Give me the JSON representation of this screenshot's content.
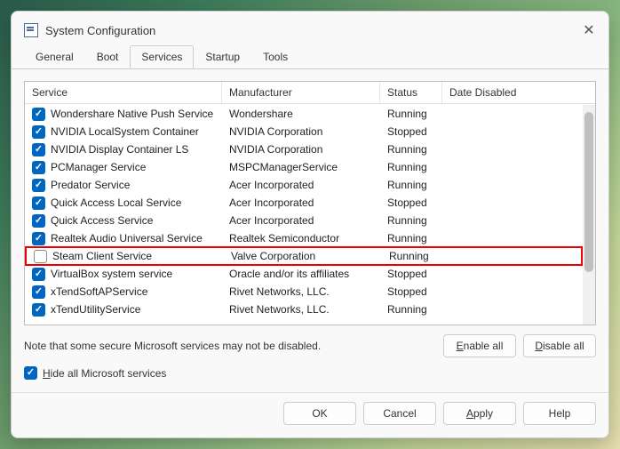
{
  "window": {
    "title": "System Configuration"
  },
  "tabs": [
    {
      "label": "General"
    },
    {
      "label": "Boot"
    },
    {
      "label": "Services",
      "active": true
    },
    {
      "label": "Startup"
    },
    {
      "label": "Tools"
    }
  ],
  "columns": {
    "service": "Service",
    "manufacturer": "Manufacturer",
    "status": "Status",
    "date": "Date Disabled"
  },
  "services": [
    {
      "checked": true,
      "name": "Wondershare Native Push Service",
      "manufacturer": "Wondershare",
      "status": "Running",
      "highlight": false
    },
    {
      "checked": true,
      "name": "NVIDIA LocalSystem Container",
      "manufacturer": "NVIDIA Corporation",
      "status": "Stopped",
      "highlight": false
    },
    {
      "checked": true,
      "name": "NVIDIA Display Container LS",
      "manufacturer": "NVIDIA Corporation",
      "status": "Running",
      "highlight": false
    },
    {
      "checked": true,
      "name": "PCManager Service",
      "manufacturer": "MSPCManagerService",
      "status": "Running",
      "highlight": false
    },
    {
      "checked": true,
      "name": "Predator Service",
      "manufacturer": "Acer Incorporated",
      "status": "Running",
      "highlight": false
    },
    {
      "checked": true,
      "name": "Quick Access Local Service",
      "manufacturer": "Acer Incorporated",
      "status": "Stopped",
      "highlight": false
    },
    {
      "checked": true,
      "name": "Quick Access Service",
      "manufacturer": "Acer Incorporated",
      "status": "Running",
      "highlight": false
    },
    {
      "checked": true,
      "name": "Realtek Audio Universal Service",
      "manufacturer": "Realtek Semiconductor",
      "status": "Running",
      "highlight": false
    },
    {
      "checked": false,
      "name": "Steam Client Service",
      "manufacturer": "Valve Corporation",
      "status": "Running",
      "highlight": true
    },
    {
      "checked": true,
      "name": "VirtualBox system service",
      "manufacturer": "Oracle and/or its affiliates",
      "status": "Stopped",
      "highlight": false
    },
    {
      "checked": true,
      "name": "xTendSoftAPService",
      "manufacturer": "Rivet Networks, LLC.",
      "status": "Stopped",
      "highlight": false
    },
    {
      "checked": true,
      "name": "xTendUtilityService",
      "manufacturer": "Rivet Networks, LLC.",
      "status": "Running",
      "highlight": false
    }
  ],
  "note": "Note that some secure Microsoft services may not be disabled.",
  "buttons": {
    "enable_all": "Enable all",
    "disable_all": "Disable all",
    "ok": "OK",
    "cancel": "Cancel",
    "apply": "Apply",
    "help": "Help"
  },
  "hide_ms": {
    "checked": true,
    "label": "Hide all Microsoft services"
  }
}
